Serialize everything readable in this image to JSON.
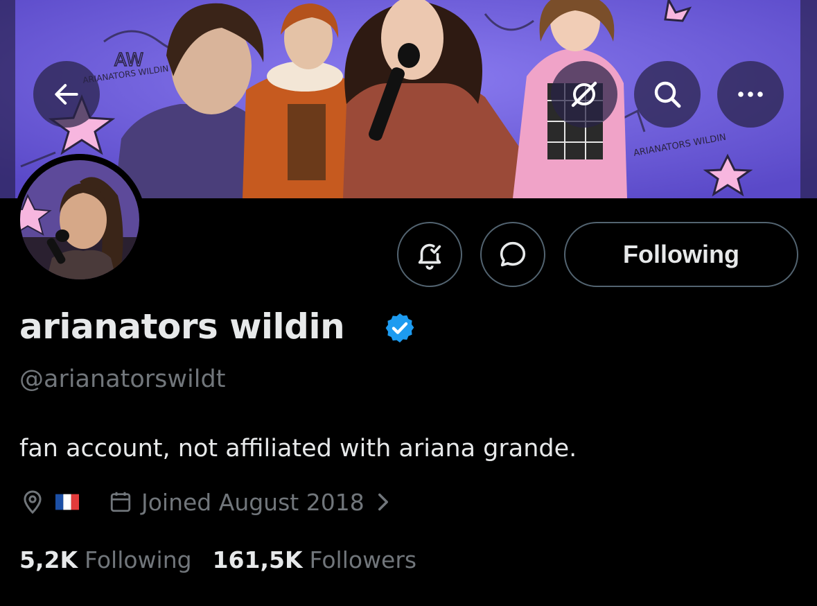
{
  "banner": {
    "background_color": "#6c5bd6",
    "sticker_text_1": "AW",
    "sticker_text_2": "ARIANATORS WILDIN",
    "sticker_text_3": "ARIANATORS WILDIN"
  },
  "top_bar": {
    "back_icon": "arrow-left-icon",
    "grok_icon": "grok-icon",
    "search_icon": "search-icon",
    "more_icon": "more-horizontal-icon"
  },
  "actions": {
    "notify_icon": "bell-check-icon",
    "message_icon": "message-bubble-icon",
    "following_label": "Following"
  },
  "profile": {
    "display_name": "arianators wildin",
    "verified": true,
    "verified_color": "#1d9bf0",
    "handle": "@arianatorswildt",
    "bio": "fan account, not affiliated with ariana grande.",
    "location_icon": "location-pin-icon",
    "location_flag": "france-flag",
    "joined_icon": "calendar-icon",
    "joined_text": "Joined August 2018"
  },
  "stats": {
    "following_count": "5,2K",
    "following_label": "Following",
    "followers_count": "161,5K",
    "followers_label": "Followers"
  },
  "colors": {
    "background": "#000000",
    "primary_text": "#e7e9ea",
    "secondary_text": "#71767b",
    "border": "#536471"
  }
}
